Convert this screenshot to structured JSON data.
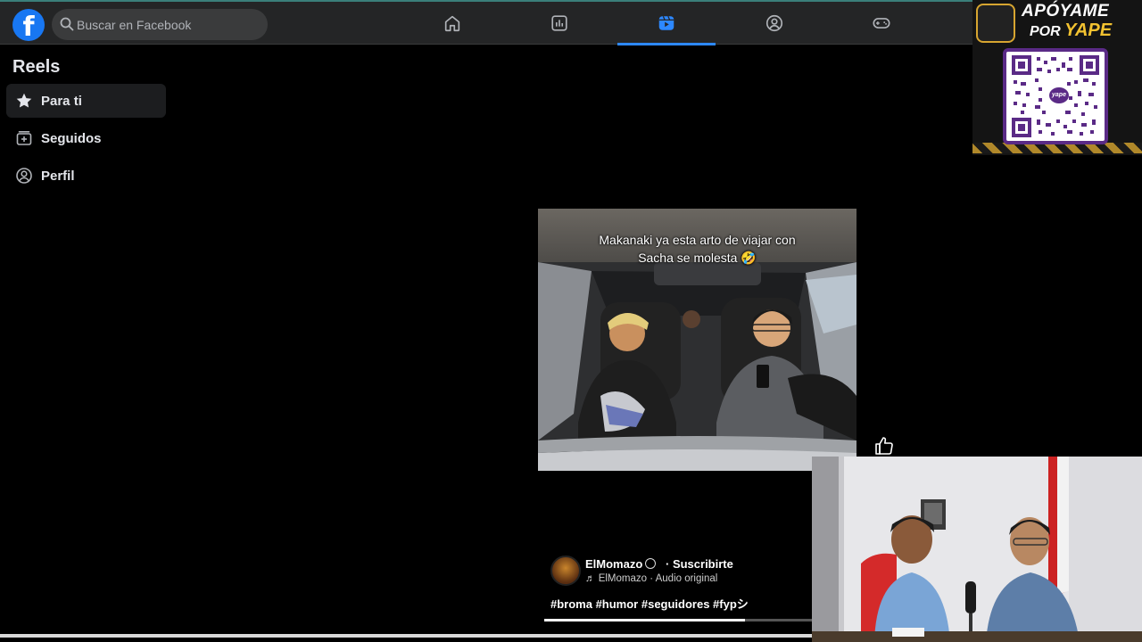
{
  "topbar": {
    "logo_letter": "f",
    "search_placeholder": "Buscar en Facebook",
    "tabs": [
      {
        "icon": "home-icon",
        "active": false
      },
      {
        "icon": "dashboard-icon",
        "active": false
      },
      {
        "icon": "reels-icon",
        "active": true
      },
      {
        "icon": "groups-icon",
        "active": false
      },
      {
        "icon": "gaming-icon",
        "active": false
      }
    ]
  },
  "sidebar": {
    "title": "Reels",
    "items": [
      {
        "label": "Para ti",
        "icon": "star-icon",
        "active": true
      },
      {
        "label": "Seguidos",
        "icon": "following-icon",
        "active": false
      },
      {
        "label": "Perfil",
        "icon": "profile-icon",
        "active": false
      }
    ]
  },
  "reel": {
    "caption_line1": "Makanaki ya esta arto de viajar con",
    "caption_line2": "Sacha se molesta 🤣",
    "author": "ElMomazo",
    "subscribe": "· Suscribirte",
    "audio": "♬ ElMomazo · Audio original",
    "hashtags": "#broma #humor #seguidores #fypシ",
    "progress": 0.75
  },
  "overlay": {
    "title": "APÓYAME",
    "sub_prefix": "POR",
    "sub_brand": "YAPE",
    "badge": "yape"
  },
  "colors": {
    "accent": "#2d88ff",
    "facebook_blue": "#1877f2",
    "topbar_bg": "#242526"
  }
}
